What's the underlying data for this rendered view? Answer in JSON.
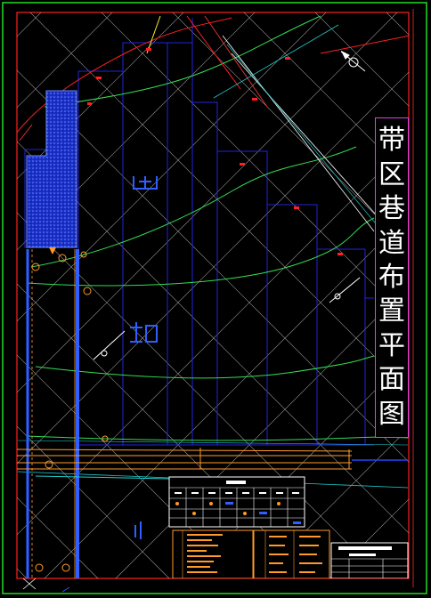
{
  "drawing": {
    "title_chars": [
      "带",
      "区",
      "巷",
      "道",
      "布",
      "置",
      "平",
      "面",
      "图"
    ]
  },
  "colors": {
    "background": "#000000",
    "frame_outer": "#22dd22",
    "frame_inner": "#ff2020",
    "grid": "#cfcfcf",
    "cells": "#2222dd",
    "contours": "#33dd55",
    "roadway": "#ff9a2a",
    "shaft": "#2f5fff",
    "fault": "#ff2020",
    "legend_border": "#ffffff",
    "title_border": "#e040e0"
  },
  "icons": {
    "north_arrow": "compass-north-arrow-icon"
  }
}
